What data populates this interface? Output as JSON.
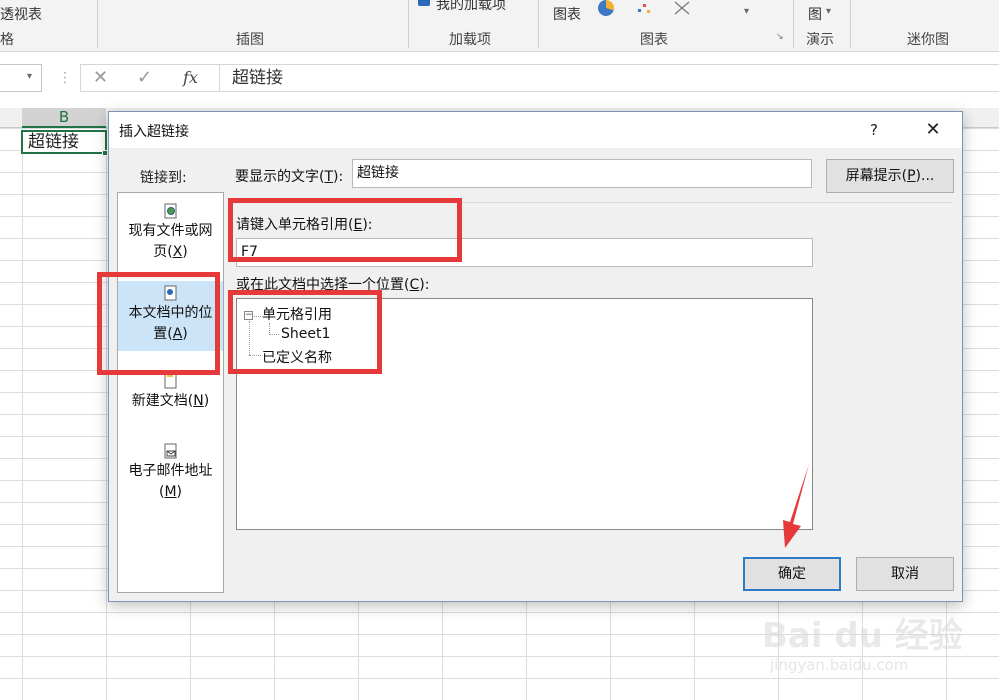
{
  "ribbon": {
    "partial_top_left": "透视表",
    "partial_group_left": "格",
    "chart_label_left": "图表",
    "chart_label_right": "图",
    "addin_label": "我的加载项",
    "groups": [
      "插图",
      "加载项",
      "图表",
      "演示",
      "迷你图"
    ]
  },
  "formula_bar": {
    "cancel_icon": "cancel-icon",
    "enter_icon": "enter-icon",
    "fx_label": "fx",
    "value": "超链接"
  },
  "sheet": {
    "column_b": "B",
    "cell_b1": "超链接"
  },
  "dialog": {
    "title": "插入超链接",
    "help": "?",
    "close": "✕",
    "link_to": "链接到:",
    "nav": [
      {
        "line1": "现有文件或网",
        "line2": "页(",
        "key": "X",
        "tail": ")"
      },
      {
        "line1": "本文档中的位",
        "line2": "置(",
        "key": "A",
        "tail": ")"
      },
      {
        "line1": "新建文档(",
        "key": "N",
        "tail": ")"
      },
      {
        "line1": "电子邮件地址",
        "line2": "(",
        "key": "M",
        "tail": ")"
      }
    ],
    "display_text_label": {
      "pre": "要显示的文字(",
      "key": "T",
      "post": "):"
    },
    "display_text_value": "超链接",
    "screentip_button": {
      "pre": "屏幕提示(",
      "key": "P",
      "post": ")..."
    },
    "cell_ref_label": {
      "pre": "请键入单元格引用(",
      "key": "E",
      "post": "):"
    },
    "cell_ref_value": "F7",
    "place_label": {
      "pre": "或在此文档中选择一个位置(",
      "key": "C",
      "post": "):"
    },
    "tree": {
      "expand_glyph": "−",
      "node1": "单元格引用",
      "child1": "Sheet1",
      "node2": "已定义名称"
    },
    "ok": "确定",
    "cancel": "取消"
  },
  "watermark": {
    "logo": "Bai du 经验",
    "url": "jingyan.baidu.com"
  },
  "colors": {
    "annotation": "#e63a3a",
    "excel_green": "#217346",
    "selection": "#cce4f7"
  }
}
